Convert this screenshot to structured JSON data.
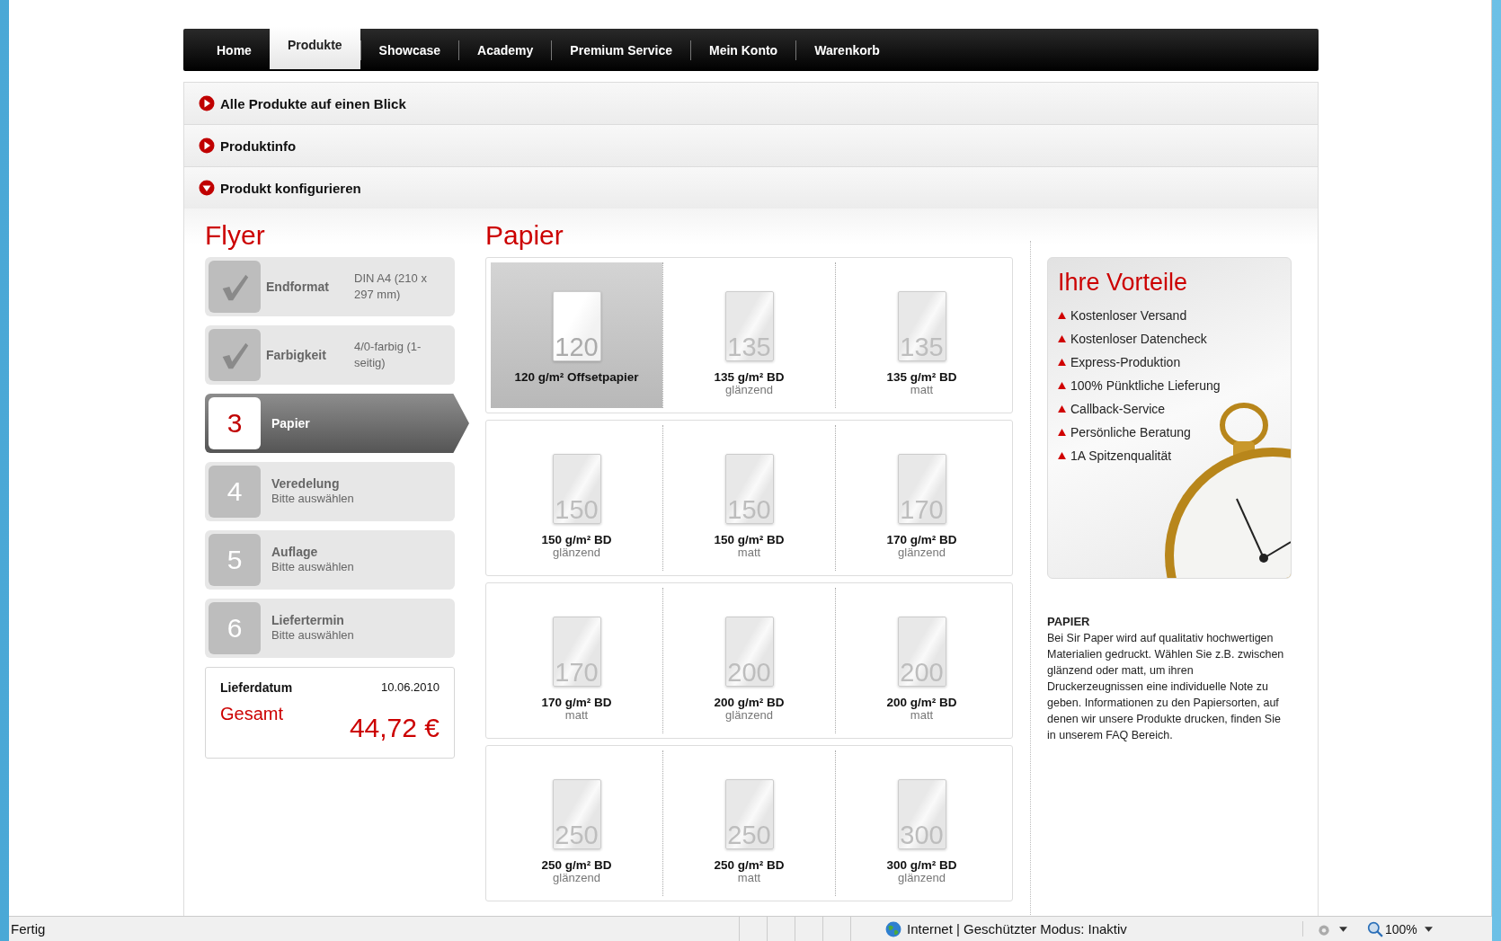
{
  "nav": {
    "tabs": [
      {
        "label": "Home",
        "selected": false
      },
      {
        "label": "Produkte",
        "selected": true
      },
      {
        "label": "Showcase",
        "selected": false
      },
      {
        "label": "Academy",
        "selected": false
      },
      {
        "label": "Premium Service",
        "selected": false
      },
      {
        "label": "Mein Konto",
        "selected": false
      },
      {
        "label": "Warenkorb",
        "selected": false
      }
    ]
  },
  "accordion": [
    {
      "label": "Alle Produkte auf einen Blick",
      "expanded": false
    },
    {
      "label": "Produktinfo",
      "expanded": false
    },
    {
      "label": "Produkt konfigurieren",
      "expanded": true
    }
  ],
  "product": {
    "title": "Flyer",
    "steps": [
      {
        "kind": "done",
        "label": "Endformat",
        "value": "DIN A4 (210 x 297 mm)"
      },
      {
        "kind": "done",
        "label": "Farbigkeit",
        "value": "4/0-farbig (1-seitig)"
      },
      {
        "kind": "active",
        "number": "3",
        "label": "Papier"
      },
      {
        "kind": "pending",
        "number": "4",
        "label": "Veredelung",
        "value": "Bitte auswählen"
      },
      {
        "kind": "pending",
        "number": "5",
        "label": "Auflage",
        "value": "Bitte auswählen"
      },
      {
        "kind": "pending",
        "number": "6",
        "label": "Liefertermin",
        "value": "Bitte auswählen"
      }
    ],
    "summary": {
      "date_label": "Lieferdatum",
      "date": "10.06.2010",
      "total_label": "Gesamt",
      "total": "44,72 €"
    }
  },
  "paper": {
    "title": "Papier",
    "options": [
      {
        "weight": "120",
        "name": "120 g/m² Offsetpapier",
        "selected": true
      },
      {
        "weight": "135",
        "name": "135 g/m² BD",
        "finish": "glänzend",
        "selected": false
      },
      {
        "weight": "135",
        "name": "135 g/m² BD",
        "finish": "matt",
        "selected": false
      },
      {
        "weight": "150",
        "name": "150 g/m² BD",
        "finish": "glänzend",
        "selected": false
      },
      {
        "weight": "150",
        "name": "150 g/m² BD",
        "finish": "matt",
        "selected": false
      },
      {
        "weight": "170",
        "name": "170 g/m² BD",
        "finish": "glänzend",
        "selected": false
      },
      {
        "weight": "170",
        "name": "170 g/m² BD",
        "finish": "matt",
        "selected": false
      },
      {
        "weight": "200",
        "name": "200 g/m² BD",
        "finish": "glänzend",
        "selected": false
      },
      {
        "weight": "200",
        "name": "200 g/m² BD",
        "finish": "matt",
        "selected": false
      },
      {
        "weight": "250",
        "name": "250 g/m² BD",
        "finish": "glänzend",
        "selected": false
      },
      {
        "weight": "250",
        "name": "250 g/m² BD",
        "finish": "matt",
        "selected": false
      },
      {
        "weight": "300",
        "name": "300 g/m² BD",
        "finish": "glänzend",
        "selected": false
      }
    ]
  },
  "benefits": {
    "title": "Ihre Vorteile",
    "items": [
      "Kostenloser Versand",
      "Kostenloser Datencheck",
      "Express-Produktion",
      "100% Pünktliche Lieferung",
      "Callback-Service",
      "Persönliche Beratung",
      "1A Spitzenqualität"
    ]
  },
  "info": {
    "heading": "PAPIER",
    "text": "Bei Sir Paper wird auf qualitativ hochwertigen Materialien gedruckt. Wählen Sie z.B. zwischen glänzend oder matt, um ihren Druckerzeugnissen eine individuelle Note zu geben. Informationen zu den Papiersorten, auf denen wir unsere Produkte drucken, finden Sie in unserem FAQ Bereich."
  },
  "status_bar": {
    "status": "Fertig",
    "zone": "Internet | Geschützter Modus: Inaktiv",
    "zoom": "100%"
  }
}
